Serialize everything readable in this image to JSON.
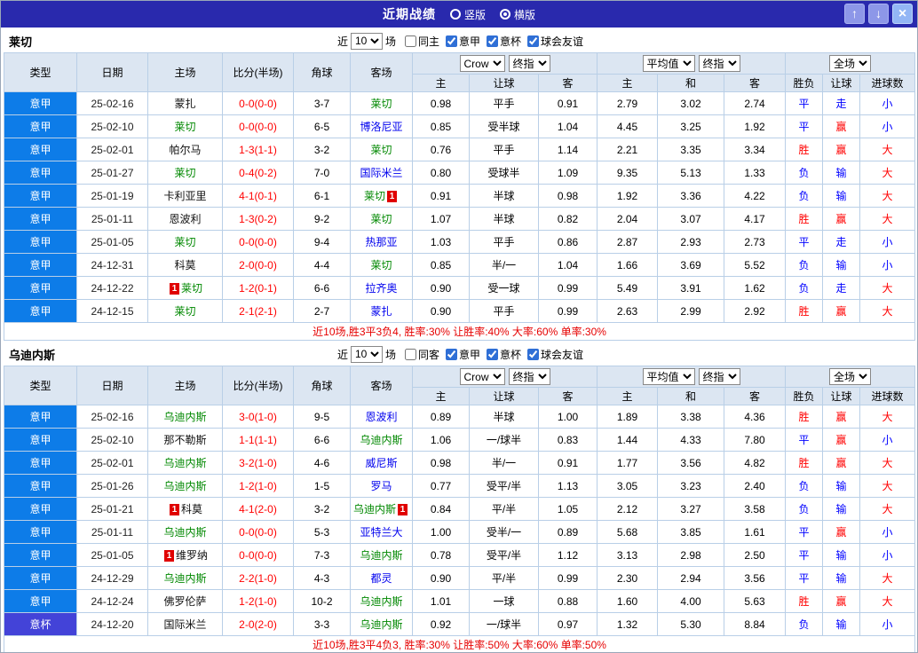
{
  "titlebar": {
    "title": "近期战绩",
    "radio_vertical": "竖版",
    "radio_horizontal": "横版",
    "vertical_checked": false,
    "horizontal_checked": true,
    "up_glyph": "↑",
    "down_glyph": "↓",
    "close_glyph": "×"
  },
  "filter": {
    "near_label": "近",
    "matches_label": "场"
  },
  "headers": {
    "cols": [
      "类型",
      "日期",
      "主场",
      "比分(半场)",
      "角球",
      "客场"
    ],
    "dd_crow": "Crow",
    "dd_final": "终指",
    "dd_avg": "平均值",
    "dd_full": "全场",
    "sub1": [
      "主",
      "让球",
      "客"
    ],
    "sub2": [
      "主",
      "和",
      "客"
    ],
    "sub3": [
      "胜负",
      "让球",
      "进球数"
    ]
  },
  "colors": {
    "titlebar_bg": "#2929ad",
    "league_cell_bg": "#0d7ce8",
    "cup_cell_bg": "#4343d8",
    "win_red": "#ff0000",
    "loss_blue": "#0000ff",
    "focus_team_green": "#008800",
    "away_team_blue": "#0000ee",
    "score_red": "#ff0000"
  },
  "tables": [
    {
      "team": "莱切",
      "count": "10",
      "filters": [
        {
          "label": "同主",
          "checked": false
        },
        {
          "label": "意甲",
          "checked": true
        },
        {
          "label": "意杯",
          "checked": true
        },
        {
          "label": "球会友谊",
          "checked": true
        }
      ],
      "rows": [
        {
          "type": "意甲",
          "cup": false,
          "date": "25-02-16",
          "home": {
            "n": "蒙扎",
            "c": "black"
          },
          "score": "0-0(0-0)",
          "corner": "3-7",
          "away": {
            "n": "莱切",
            "c": "green"
          },
          "odds": [
            "0.98",
            "平手",
            "0.91"
          ],
          "avg": [
            "2.79",
            "3.02",
            "2.74"
          ],
          "res": [
            [
              "平",
              "b"
            ],
            [
              "走",
              "b"
            ],
            [
              "小",
              "b"
            ]
          ]
        },
        {
          "type": "意甲",
          "cup": false,
          "date": "25-02-10",
          "home": {
            "n": "莱切",
            "c": "green"
          },
          "score": "0-0(0-0)",
          "corner": "6-5",
          "away": {
            "n": "博洛尼亚",
            "c": "blue"
          },
          "odds": [
            "0.85",
            "受半球",
            "1.04"
          ],
          "avg": [
            "4.45",
            "3.25",
            "1.92"
          ],
          "res": [
            [
              "平",
              "b"
            ],
            [
              "赢",
              "r"
            ],
            [
              "小",
              "b"
            ]
          ]
        },
        {
          "type": "意甲",
          "cup": false,
          "date": "25-02-01",
          "home": {
            "n": "帕尔马",
            "c": "black"
          },
          "score": "1-3(1-1)",
          "corner": "3-2",
          "away": {
            "n": "莱切",
            "c": "green"
          },
          "odds": [
            "0.76",
            "平手",
            "1.14"
          ],
          "avg": [
            "2.21",
            "3.35",
            "3.34"
          ],
          "res": [
            [
              "胜",
              "r"
            ],
            [
              "赢",
              "r"
            ],
            [
              "大",
              "r"
            ]
          ]
        },
        {
          "type": "意甲",
          "cup": false,
          "date": "25-01-27",
          "home": {
            "n": "莱切",
            "c": "green"
          },
          "score": "0-4(0-2)",
          "corner": "7-0",
          "away": {
            "n": "国际米兰",
            "c": "blue"
          },
          "odds": [
            "0.80",
            "受球半",
            "1.09"
          ],
          "avg": [
            "9.35",
            "5.13",
            "1.33"
          ],
          "res": [
            [
              "负",
              "b"
            ],
            [
              "输",
              "b"
            ],
            [
              "大",
              "r"
            ]
          ]
        },
        {
          "type": "意甲",
          "cup": false,
          "date": "25-01-19",
          "home": {
            "n": "卡利亚里",
            "c": "black"
          },
          "score": "4-1(0-1)",
          "corner": "6-1",
          "away": {
            "n": "莱切",
            "c": "green",
            "post": "1"
          },
          "odds": [
            "0.91",
            "半球",
            "0.98"
          ],
          "avg": [
            "1.92",
            "3.36",
            "4.22"
          ],
          "res": [
            [
              "负",
              "b"
            ],
            [
              "输",
              "b"
            ],
            [
              "大",
              "r"
            ]
          ]
        },
        {
          "type": "意甲",
          "cup": false,
          "date": "25-01-11",
          "home": {
            "n": "恩波利",
            "c": "black"
          },
          "score": "1-3(0-2)",
          "corner": "9-2",
          "away": {
            "n": "莱切",
            "c": "green"
          },
          "odds": [
            "1.07",
            "半球",
            "0.82"
          ],
          "avg": [
            "2.04",
            "3.07",
            "4.17"
          ],
          "res": [
            [
              "胜",
              "r"
            ],
            [
              "赢",
              "r"
            ],
            [
              "大",
              "r"
            ]
          ]
        },
        {
          "type": "意甲",
          "cup": false,
          "date": "25-01-05",
          "home": {
            "n": "莱切",
            "c": "green"
          },
          "score": "0-0(0-0)",
          "corner": "9-4",
          "away": {
            "n": "热那亚",
            "c": "blue"
          },
          "odds": [
            "1.03",
            "平手",
            "0.86"
          ],
          "avg": [
            "2.87",
            "2.93",
            "2.73"
          ],
          "res": [
            [
              "平",
              "b"
            ],
            [
              "走",
              "b"
            ],
            [
              "小",
              "b"
            ]
          ]
        },
        {
          "type": "意甲",
          "cup": false,
          "date": "24-12-31",
          "home": {
            "n": "科莫",
            "c": "black"
          },
          "score": "2-0(0-0)",
          "corner": "4-4",
          "away": {
            "n": "莱切",
            "c": "green"
          },
          "odds": [
            "0.85",
            "半/一",
            "1.04"
          ],
          "avg": [
            "1.66",
            "3.69",
            "5.52"
          ],
          "res": [
            [
              "负",
              "b"
            ],
            [
              "输",
              "b"
            ],
            [
              "小",
              "b"
            ]
          ]
        },
        {
          "type": "意甲",
          "cup": false,
          "date": "24-12-22",
          "home": {
            "n": "莱切",
            "c": "green",
            "pre": "1"
          },
          "score": "1-2(0-1)",
          "corner": "6-6",
          "away": {
            "n": "拉齐奥",
            "c": "blue"
          },
          "odds": [
            "0.90",
            "受一球",
            "0.99"
          ],
          "avg": [
            "5.49",
            "3.91",
            "1.62"
          ],
          "res": [
            [
              "负",
              "b"
            ],
            [
              "走",
              "b"
            ],
            [
              "大",
              "r"
            ]
          ]
        },
        {
          "type": "意甲",
          "cup": false,
          "date": "24-12-15",
          "home": {
            "n": "莱切",
            "c": "green"
          },
          "score": "2-1(2-1)",
          "corner": "2-7",
          "away": {
            "n": "蒙扎",
            "c": "blue"
          },
          "odds": [
            "0.90",
            "平手",
            "0.99"
          ],
          "avg": [
            "2.63",
            "2.99",
            "2.92"
          ],
          "res": [
            [
              "胜",
              "r"
            ],
            [
              "赢",
              "r"
            ],
            [
              "大",
              "r"
            ]
          ]
        }
      ],
      "summary": "近10场,胜3平3负4, 胜率:30% 让胜率:40% 大率:60% 单率:30%"
    },
    {
      "team": "乌迪内斯",
      "count": "10",
      "filters": [
        {
          "label": "同客",
          "checked": false
        },
        {
          "label": "意甲",
          "checked": true
        },
        {
          "label": "意杯",
          "checked": true
        },
        {
          "label": "球会友谊",
          "checked": true
        }
      ],
      "rows": [
        {
          "type": "意甲",
          "cup": false,
          "date": "25-02-16",
          "home": {
            "n": "乌迪内斯",
            "c": "green"
          },
          "score": "3-0(1-0)",
          "corner": "9-5",
          "away": {
            "n": "恩波利",
            "c": "blue"
          },
          "odds": [
            "0.89",
            "半球",
            "1.00"
          ],
          "avg": [
            "1.89",
            "3.38",
            "4.36"
          ],
          "res": [
            [
              "胜",
              "r"
            ],
            [
              "赢",
              "r"
            ],
            [
              "大",
              "r"
            ]
          ]
        },
        {
          "type": "意甲",
          "cup": false,
          "date": "25-02-10",
          "home": {
            "n": "那不勒斯",
            "c": "black"
          },
          "score": "1-1(1-1)",
          "corner": "6-6",
          "away": {
            "n": "乌迪内斯",
            "c": "green"
          },
          "odds": [
            "1.06",
            "一/球半",
            "0.83"
          ],
          "avg": [
            "1.44",
            "4.33",
            "7.80"
          ],
          "res": [
            [
              "平",
              "b"
            ],
            [
              "赢",
              "r"
            ],
            [
              "小",
              "b"
            ]
          ]
        },
        {
          "type": "意甲",
          "cup": false,
          "date": "25-02-01",
          "home": {
            "n": "乌迪内斯",
            "c": "green"
          },
          "score": "3-2(1-0)",
          "corner": "4-6",
          "away": {
            "n": "威尼斯",
            "c": "blue"
          },
          "odds": [
            "0.98",
            "半/一",
            "0.91"
          ],
          "avg": [
            "1.77",
            "3.56",
            "4.82"
          ],
          "res": [
            [
              "胜",
              "r"
            ],
            [
              "赢",
              "r"
            ],
            [
              "大",
              "r"
            ]
          ]
        },
        {
          "type": "意甲",
          "cup": false,
          "date": "25-01-26",
          "home": {
            "n": "乌迪内斯",
            "c": "green"
          },
          "score": "1-2(1-0)",
          "corner": "1-5",
          "away": {
            "n": "罗马",
            "c": "blue"
          },
          "odds": [
            "0.77",
            "受平/半",
            "1.13"
          ],
          "avg": [
            "3.05",
            "3.23",
            "2.40"
          ],
          "res": [
            [
              "负",
              "b"
            ],
            [
              "输",
              "b"
            ],
            [
              "大",
              "r"
            ]
          ]
        },
        {
          "type": "意甲",
          "cup": false,
          "date": "25-01-21",
          "home": {
            "n": "科莫",
            "c": "black",
            "pre": "1"
          },
          "score": "4-1(2-0)",
          "corner": "3-2",
          "away": {
            "n": "乌迪内斯",
            "c": "green",
            "post": "1"
          },
          "odds": [
            "0.84",
            "平/半",
            "1.05"
          ],
          "avg": [
            "2.12",
            "3.27",
            "3.58"
          ],
          "res": [
            [
              "负",
              "b"
            ],
            [
              "输",
              "b"
            ],
            [
              "大",
              "r"
            ]
          ]
        },
        {
          "type": "意甲",
          "cup": false,
          "date": "25-01-11",
          "home": {
            "n": "乌迪内斯",
            "c": "green"
          },
          "score": "0-0(0-0)",
          "corner": "5-3",
          "away": {
            "n": "亚特兰大",
            "c": "blue"
          },
          "odds": [
            "1.00",
            "受半/一",
            "0.89"
          ],
          "avg": [
            "5.68",
            "3.85",
            "1.61"
          ],
          "res": [
            [
              "平",
              "b"
            ],
            [
              "赢",
              "r"
            ],
            [
              "小",
              "b"
            ]
          ]
        },
        {
          "type": "意甲",
          "cup": false,
          "date": "25-01-05",
          "home": {
            "n": "维罗纳",
            "c": "black",
            "pre": "1"
          },
          "score": "0-0(0-0)",
          "corner": "7-3",
          "away": {
            "n": "乌迪内斯",
            "c": "green"
          },
          "odds": [
            "0.78",
            "受平/半",
            "1.12"
          ],
          "avg": [
            "3.13",
            "2.98",
            "2.50"
          ],
          "res": [
            [
              "平",
              "b"
            ],
            [
              "输",
              "b"
            ],
            [
              "小",
              "b"
            ]
          ]
        },
        {
          "type": "意甲",
          "cup": false,
          "date": "24-12-29",
          "home": {
            "n": "乌迪内斯",
            "c": "green"
          },
          "score": "2-2(1-0)",
          "corner": "4-3",
          "away": {
            "n": "都灵",
            "c": "blue"
          },
          "odds": [
            "0.90",
            "平/半",
            "0.99"
          ],
          "avg": [
            "2.30",
            "2.94",
            "3.56"
          ],
          "res": [
            [
              "平",
              "b"
            ],
            [
              "输",
              "b"
            ],
            [
              "大",
              "r"
            ]
          ]
        },
        {
          "type": "意甲",
          "cup": false,
          "date": "24-12-24",
          "home": {
            "n": "佛罗伦萨",
            "c": "black"
          },
          "score": "1-2(1-0)",
          "corner": "10-2",
          "away": {
            "n": "乌迪内斯",
            "c": "green"
          },
          "odds": [
            "1.01",
            "一球",
            "0.88"
          ],
          "avg": [
            "1.60",
            "4.00",
            "5.63"
          ],
          "res": [
            [
              "胜",
              "r"
            ],
            [
              "赢",
              "r"
            ],
            [
              "大",
              "r"
            ]
          ]
        },
        {
          "type": "意杯",
          "cup": true,
          "date": "24-12-20",
          "home": {
            "n": "国际米兰",
            "c": "black"
          },
          "score": "2-0(2-0)",
          "corner": "3-3",
          "away": {
            "n": "乌迪内斯",
            "c": "green"
          },
          "odds": [
            "0.92",
            "一/球半",
            "0.97"
          ],
          "avg": [
            "1.32",
            "5.30",
            "8.84"
          ],
          "res": [
            [
              "负",
              "b"
            ],
            [
              "输",
              "b"
            ],
            [
              "小",
              "b"
            ]
          ]
        }
      ],
      "summary": "近10场,胜3平4负3, 胜率:30% 让胜率:50% 大率:60% 单率:50%"
    }
  ]
}
